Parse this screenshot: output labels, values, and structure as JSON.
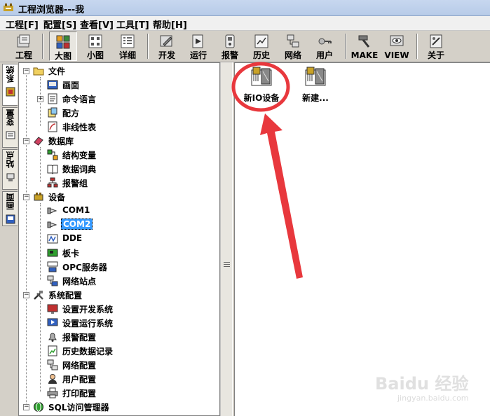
{
  "window": {
    "title": "工程浏览器---我"
  },
  "menu": [
    {
      "id": "project",
      "label": "工程[F]"
    },
    {
      "id": "config",
      "label": "配置[S]"
    },
    {
      "id": "view",
      "label": "查看[V]"
    },
    {
      "id": "tools",
      "label": "工具[T]"
    },
    {
      "id": "help",
      "label": "帮助[H]"
    }
  ],
  "toolbar": {
    "project": "工程",
    "large": "大图",
    "small": "小图",
    "detail": "详细",
    "develop": "开发",
    "run": "运行",
    "alarm": "报警",
    "history": "历史",
    "network": "网络",
    "user": "用户",
    "make": "MAKE",
    "view": "VIEW",
    "about": "关于"
  },
  "side_tabs": {
    "system": "系统",
    "variables": "变量",
    "station": "站点",
    "screen": "画面"
  },
  "tree": {
    "file": "文件",
    "screen": "画面",
    "command_language": "命令语言",
    "recipe": "配方",
    "nonlinear_table": "非线性表",
    "database": "数据库",
    "struct_var": "结构变量",
    "data_dict": "数据词典",
    "alarm_group": "报警组",
    "device": "设备",
    "com1": "COM1",
    "com2": "COM2",
    "dde": "DDE",
    "board": "板卡",
    "opc_server": "OPC服务器",
    "net_station": "网络站点",
    "sys_config": "系统配置",
    "set_dev_sys": "设置开发系统",
    "set_run_sys": "设置运行系统",
    "alarm_config": "报警配置",
    "history_record": "历史数据记录",
    "net_config": "网络配置",
    "user_config": "用户配置",
    "print_config": "打印配置",
    "sql_manager": "SQL访问管理器"
  },
  "devices": [
    {
      "label": "新IO设备"
    },
    {
      "label": "新建..."
    }
  ],
  "colors": {
    "annotation": "#e8383d",
    "selection": "#3399ff"
  },
  "watermark": {
    "brand": "Baidu 经验",
    "url": "jingyan.baidu.com"
  }
}
